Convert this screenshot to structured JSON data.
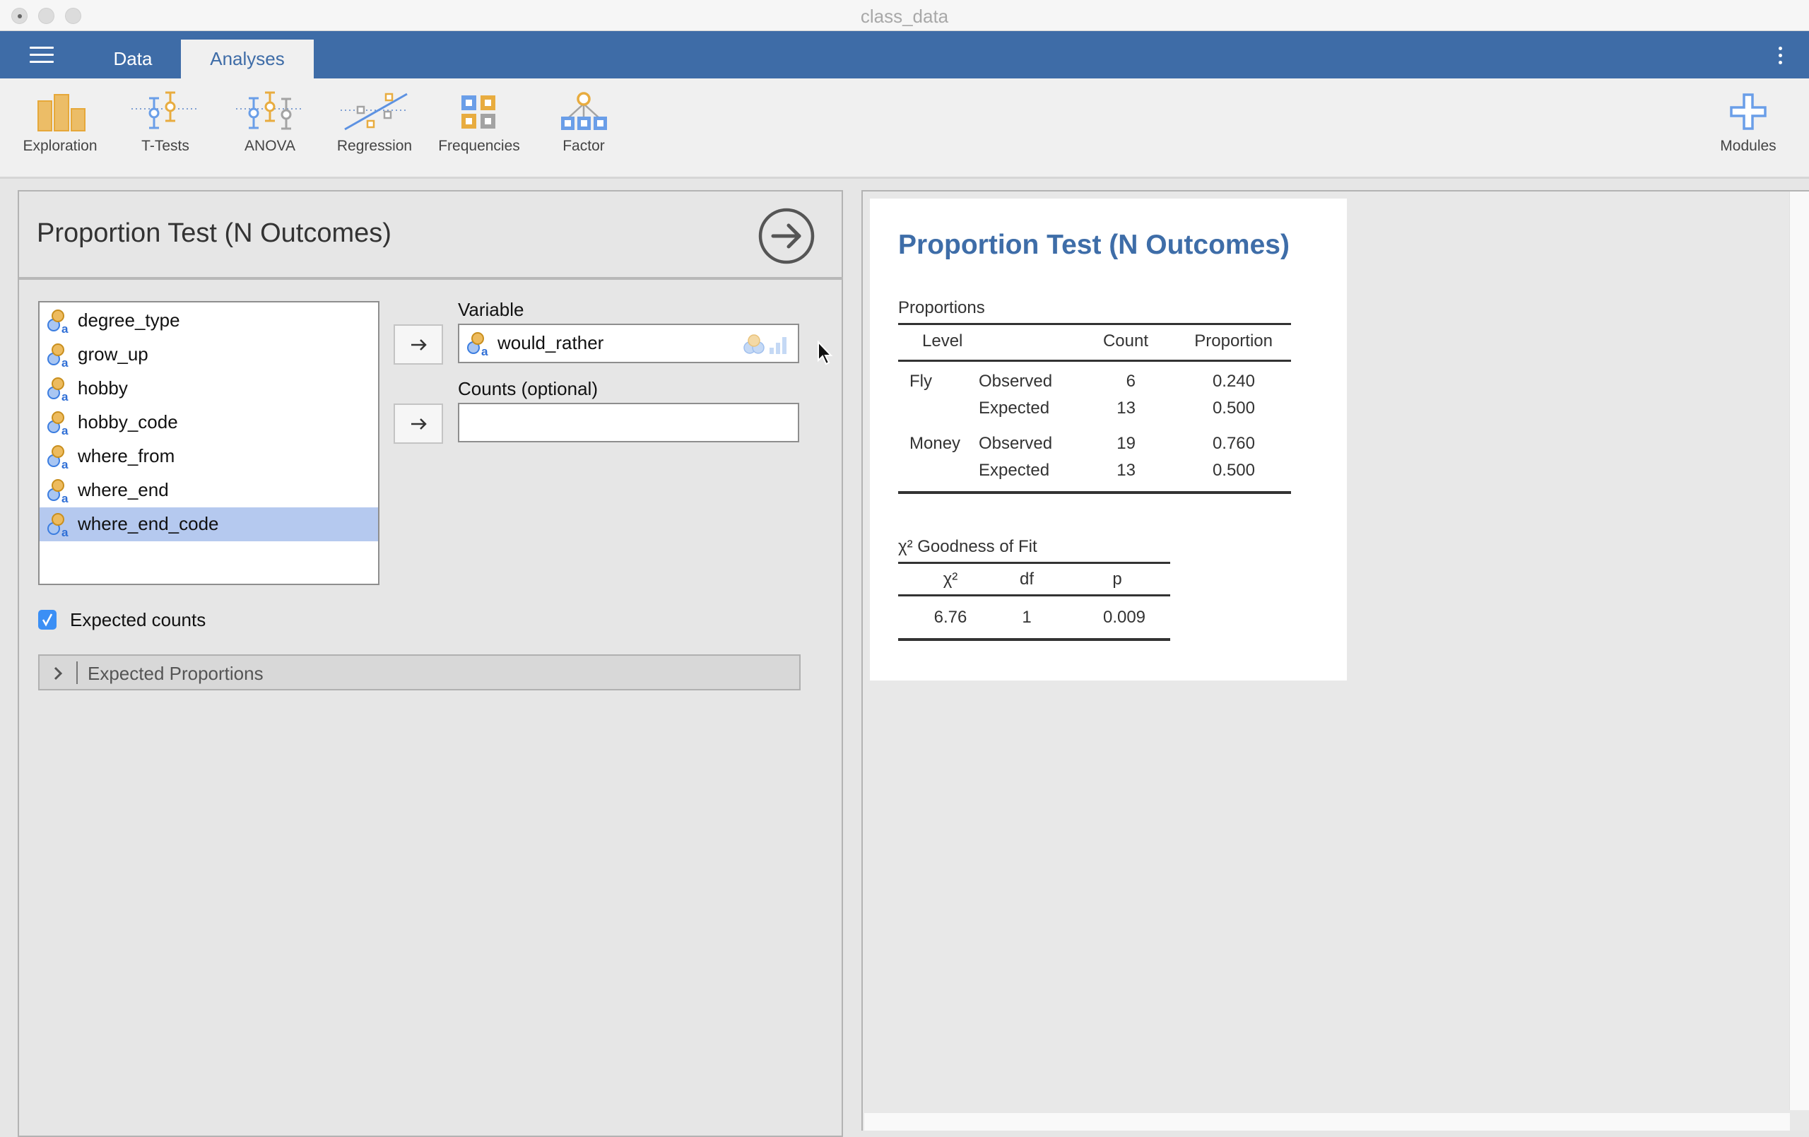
{
  "window": {
    "title": "class_data"
  },
  "header": {
    "tabs": [
      {
        "label": "Data",
        "active": false
      },
      {
        "label": "Analyses",
        "active": true
      }
    ]
  },
  "toolbar": {
    "items": [
      {
        "label": "Exploration",
        "icon": "bar-chart-icon"
      },
      {
        "label": "T-Tests",
        "icon": "ttest-icon"
      },
      {
        "label": "ANOVA",
        "icon": "anova-icon"
      },
      {
        "label": "Regression",
        "icon": "regression-icon"
      },
      {
        "label": "Frequencies",
        "icon": "frequencies-icon"
      },
      {
        "label": "Factor",
        "icon": "factor-icon"
      }
    ],
    "modules_label": "Modules"
  },
  "options": {
    "title": "Proportion Test (N Outcomes)",
    "variables": [
      {
        "name": "degree_type",
        "selected": false
      },
      {
        "name": "grow_up",
        "selected": false
      },
      {
        "name": "hobby",
        "selected": false
      },
      {
        "name": "hobby_code",
        "selected": false
      },
      {
        "name": "where_from",
        "selected": false
      },
      {
        "name": "where_end",
        "selected": false
      },
      {
        "name": "where_end_code",
        "selected": true
      }
    ],
    "variable_label": "Variable",
    "variable_value": "would_rather",
    "counts_label": "Counts (optional)",
    "counts_value": "",
    "expected_counts_label": "Expected counts",
    "expected_counts_checked": true,
    "expected_proportions_label": "Expected Proportions"
  },
  "results": {
    "title": "Proportion Test (N Outcomes)",
    "proportions_table": {
      "title": "Proportions",
      "headers": [
        "Level",
        "",
        "Count",
        "Proportion"
      ],
      "rows": [
        {
          "level": "Fly",
          "type": "Observed",
          "count": "6",
          "proportion": "0.240"
        },
        {
          "level": "",
          "type": "Expected",
          "count": "13",
          "proportion": "0.500"
        },
        {
          "level": "Money",
          "type": "Observed",
          "count": "19",
          "proportion": "0.760"
        },
        {
          "level": "",
          "type": "Expected",
          "count": "13",
          "proportion": "0.500"
        }
      ]
    },
    "gof_table": {
      "title": "χ² Goodness of Fit",
      "headers": [
        "χ²",
        "df",
        "p"
      ],
      "rows": [
        {
          "chi2": "6.76",
          "df": "1",
          "p": "0.009"
        }
      ]
    }
  },
  "colors": {
    "brand_blue": "#3e6ca7",
    "accent_orange": "#e8ac3f",
    "accent_blue": "#6a9ee8",
    "selection": "#b5c9ef",
    "checkbox": "#3b8ff5"
  }
}
